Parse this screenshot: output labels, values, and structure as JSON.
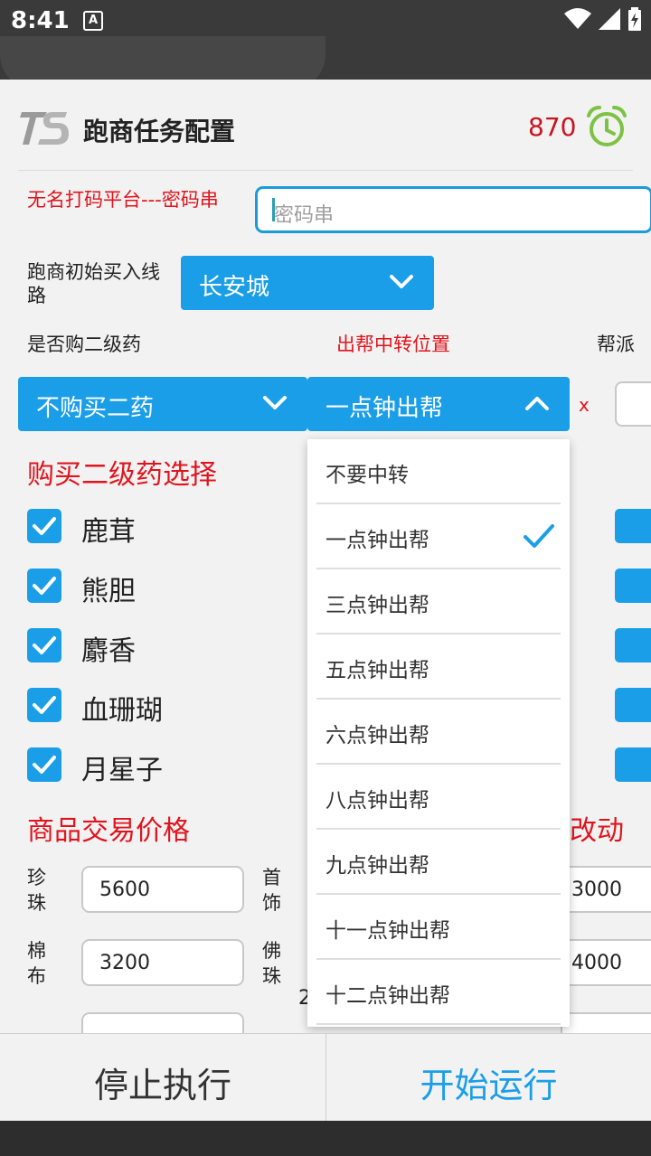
{
  "status_bar": {
    "time": "8:41",
    "notification_badge": "A"
  },
  "header": {
    "title": "跑商任务配置",
    "counter": "870"
  },
  "form": {
    "password_label": "无名打码平台---密码串",
    "password_placeholder": "密码串",
    "route_label": "跑商初始买入线路",
    "route_value": "长安城",
    "buy_secondary_label": "是否购二级药",
    "buy_secondary_value": "不购买二药",
    "transfer_label": "出帮中转位置",
    "transfer_value": "一点钟出帮",
    "gang_label_partial": "帮派",
    "x_mark": "x"
  },
  "secondary_med": {
    "title": "购买二级药选择",
    "items": [
      {
        "label": "鹿茸",
        "checked": true
      },
      {
        "label": "熊胆",
        "checked": true
      },
      {
        "label": "麝香",
        "checked": true
      },
      {
        "label": "血珊瑚",
        "checked": true
      },
      {
        "label": "月星子",
        "checked": true
      }
    ]
  },
  "prices": {
    "title": "商品交易价格",
    "right_title_partial": "改动",
    "rows": [
      {
        "left_label": "珍珠",
        "left_value": "5600",
        "mid_label": "首饰",
        "right_value": "3000"
      },
      {
        "left_label": "棉布",
        "left_value": "3200",
        "mid_label": "佛珠",
        "right_value": "4000"
      }
    ],
    "stray_digit": "2"
  },
  "dropdown": {
    "items": [
      {
        "label": "不要中转",
        "selected": false
      },
      {
        "label": "一点钟出帮",
        "selected": true
      },
      {
        "label": "三点钟出帮",
        "selected": false
      },
      {
        "label": "五点钟出帮",
        "selected": false
      },
      {
        "label": "六点钟出帮",
        "selected": false
      },
      {
        "label": "八点钟出帮",
        "selected": false
      },
      {
        "label": "九点钟出帮",
        "selected": false
      },
      {
        "label": "十一点钟出帮",
        "selected": false
      },
      {
        "label": "十二点钟出帮",
        "selected": false
      }
    ]
  },
  "buttons": {
    "stop": "停止执行",
    "start": "开始运行"
  },
  "colors": {
    "accent": "#1b9ee8",
    "red": "#e0141e",
    "counter": "#c8141e",
    "alarm": "#7cc243"
  }
}
